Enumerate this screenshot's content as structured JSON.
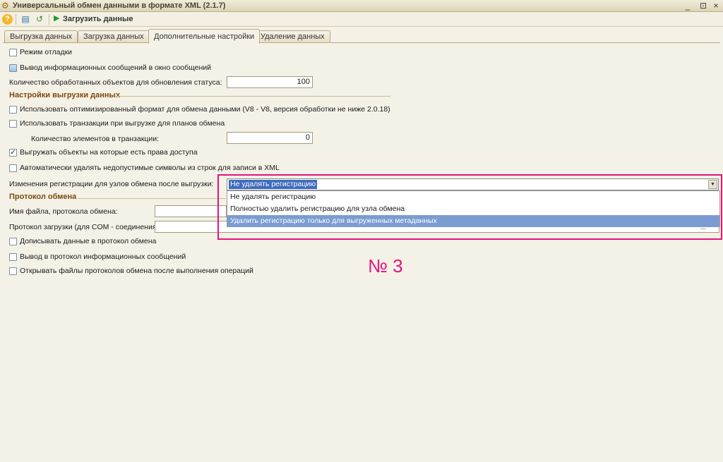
{
  "window": {
    "title": "Универсальный обмен данными в формате XML (2.1.7)",
    "controls": [
      "_",
      "⊡",
      "×"
    ]
  },
  "toolbar": {
    "help_icon": "?",
    "run_label": "Загрузить данные"
  },
  "tabs": [
    {
      "label": "Выгрузка данных"
    },
    {
      "label": "Загрузка данных"
    },
    {
      "label": "Дополнительные настройки",
      "active": true
    },
    {
      "label": "Удаление данных"
    }
  ],
  "settings": {
    "debug_mode": {
      "label": "Режим отладки",
      "checked": false
    },
    "info_messages": {
      "label": "Вывод информационных сообщений в окно сообщений",
      "checked": false
    },
    "objects_count": {
      "label": "Количество обработанных объектов для обновления статуса:",
      "value": "100"
    }
  },
  "export_section": {
    "title": "Настройки выгрузки данных",
    "optimized_format": {
      "label": "Использовать оптимизированный формат для обмена данными (V8 - V8, версия обработки не ниже 2.0.18)",
      "checked": false
    },
    "use_transactions": {
      "label": "Использовать транзакции при выгрузке для планов обмена",
      "checked": false
    },
    "transaction_count": {
      "label": "Количество элементов в транзакции:",
      "value": "0"
    },
    "access_rights": {
      "label": "Выгружать объекты на которые есть права доступа",
      "checked": true
    },
    "remove_invalid": {
      "label": "Автоматически удалять недопустимые символы из строк для записи в XML",
      "checked": false
    },
    "registration_change": {
      "label": "Изменения регистрации для узлов обмена после выгрузки:",
      "value": "Не удалять регистрацию",
      "options": [
        "Не удалять регистрацию",
        "Полностью удалить регистрацию для узла обмена",
        "Удалить регистрацию только для выгруженных метаданных"
      ],
      "highlighted_index": 2
    }
  },
  "protocol_section": {
    "title": "Протокол обмена",
    "file_name": {
      "label": "Имя файла, протокола обмена:",
      "value": ""
    },
    "load_protocol": {
      "label": "Протокол загрузки (для COM - соединения):",
      "value": "",
      "browse": "..."
    },
    "append_data": {
      "label": "Дописывать данные в протокол обмена",
      "checked": false
    },
    "info_to_protocol": {
      "label": "Вывод в протокол информационных сообщений",
      "checked": false
    },
    "open_files": {
      "label": "Открывать файлы протоколов обмена после выполнения операций",
      "checked": false
    }
  },
  "annotation": {
    "label": "№ 3",
    "color": "#e5137e"
  }
}
